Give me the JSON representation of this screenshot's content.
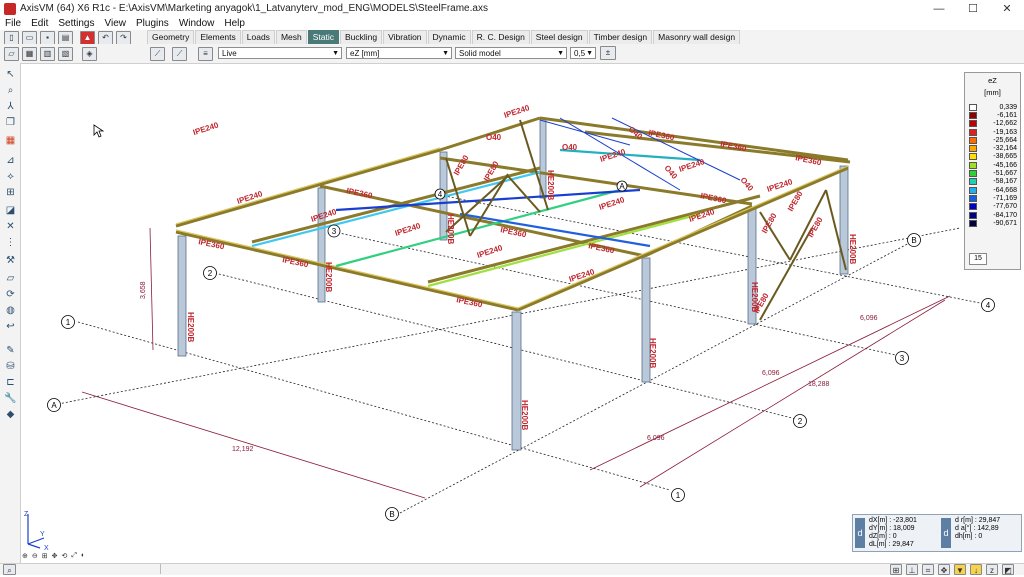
{
  "window": {
    "title": "AxisVM (64) X6 R1c - E:\\AxisVM\\Marketing anyagok\\1_Latvanyterv_mod_ENG\\MODELS\\SteelFrame.axs",
    "min": "—",
    "max": "☐",
    "close": "✕"
  },
  "menu": [
    "File",
    "Edit",
    "Settings",
    "View",
    "Plugins",
    "Window",
    "Help"
  ],
  "tabs": [
    "Geometry",
    "Elements",
    "Loads",
    "Mesh",
    "Static",
    "Buckling",
    "Vibration",
    "Dynamic",
    "R. C. Design",
    "Steel design",
    "Timber design",
    "Masonry wall design"
  ],
  "active_tab": "Static",
  "toolbar": {
    "load_case": "Live",
    "component": "eZ [mm]",
    "display_mode": "Solid model",
    "scale": "0,5"
  },
  "legend": {
    "title": "eZ",
    "unit": "[mm]",
    "rows": [
      {
        "value": "0,339",
        "color": "#ffffff"
      },
      {
        "value": "-6,161",
        "color": "#8b0000"
      },
      {
        "value": "-12,662",
        "color": "#c00000"
      },
      {
        "value": "-19,163",
        "color": "#e02020"
      },
      {
        "value": "-25,664",
        "color": "#ff6a00"
      },
      {
        "value": "-32,164",
        "color": "#ffa500"
      },
      {
        "value": "-38,665",
        "color": "#ffe000"
      },
      {
        "value": "-45,166",
        "color": "#a0e020"
      },
      {
        "value": "-51,667",
        "color": "#30d030"
      },
      {
        "value": "-58,167",
        "color": "#20d0b0"
      },
      {
        "value": "-64,668",
        "color": "#20b0f0"
      },
      {
        "value": "-71,169",
        "color": "#1060e0"
      },
      {
        "value": "-77,670",
        "color": "#0000c0"
      },
      {
        "value": "-84,170",
        "color": "#000080"
      },
      {
        "value": "-90,671",
        "color": "#000040"
      }
    ],
    "count": "15"
  },
  "coords": {
    "dX": "dX[m] : -23,801",
    "dY": "dY[m] : 18,009",
    "dZ": "dZ[m] : 0",
    "dL": "dL[m] : 29,847",
    "dr": "d r[m] : 29,847",
    "da": "d a[°] : 142,89",
    "dh": "dh[m] : 0"
  },
  "model_labels": {
    "beam": "IPE240",
    "beam2": "IPE360",
    "column": "HE200B",
    "brace": "IPE80",
    "rod": "O40",
    "dim_height": "3,658",
    "dim_span": "12,192",
    "dim_bay1": "6,096",
    "dim_bay2": "6,096",
    "dim_bay3": "6,096",
    "dim_total": "18,288",
    "axes": [
      "A",
      "B",
      "1",
      "2",
      "3",
      "4"
    ],
    "axis_z": "Z",
    "axis_y": "Y",
    "axis_x": "X"
  },
  "zoom_tools": [
    "⊕",
    "⊖",
    "⊞",
    "✥",
    "⟲",
    "⤢",
    "◐"
  ]
}
